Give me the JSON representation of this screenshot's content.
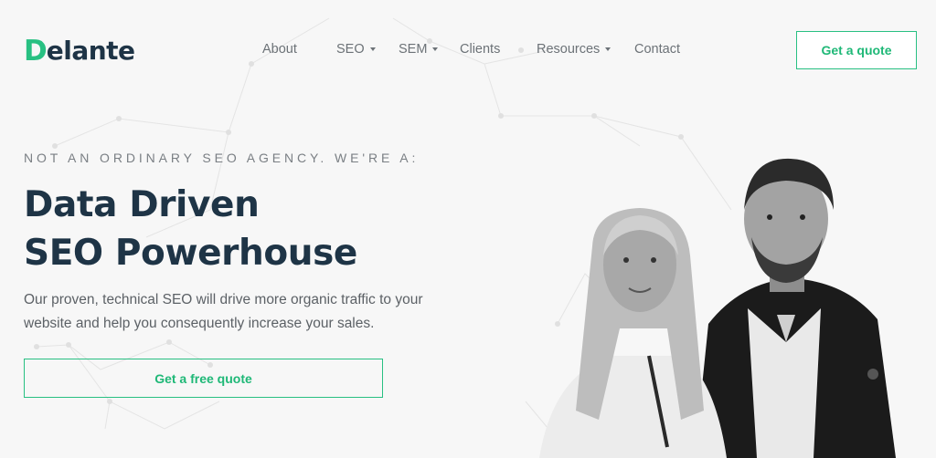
{
  "brand": {
    "logo_initial": "D",
    "logo_rest": "elante",
    "accent_color": "#28c082",
    "text_color": "#1e3446"
  },
  "nav": {
    "items": [
      {
        "label": "About",
        "has_dropdown": false
      },
      {
        "label": "SEO",
        "has_dropdown": true
      },
      {
        "label": "SEM",
        "has_dropdown": true
      },
      {
        "label": "Clients",
        "has_dropdown": false
      },
      {
        "label": "Resources",
        "has_dropdown": true
      },
      {
        "label": "Contact",
        "has_dropdown": false
      }
    ],
    "cta_label": "Get a quote"
  },
  "hero": {
    "eyebrow": "NOT AN ORDINARY SEO AGENCY. WE'RE A:",
    "headline_line1": "Data Driven",
    "headline_line2": "SEO Powerhouse",
    "lead": "Our proven, technical SEO will drive more organic traffic to your website and help you consequently increase your sales.",
    "cta_label": "Get a free quote"
  }
}
